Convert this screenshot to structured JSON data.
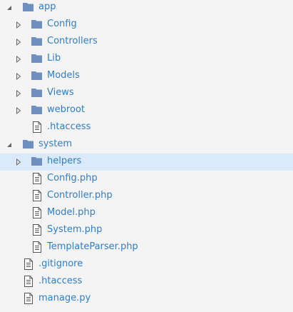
{
  "tree": {
    "nodes": [
      {
        "label": "app",
        "type": "folder",
        "level": 0,
        "state": "expanded"
      },
      {
        "label": "Config",
        "type": "folder",
        "level": 1,
        "state": "collapsed"
      },
      {
        "label": "Controllers",
        "type": "folder",
        "level": 1,
        "state": "collapsed"
      },
      {
        "label": "Lib",
        "type": "folder",
        "level": 1,
        "state": "collapsed"
      },
      {
        "label": "Models",
        "type": "folder",
        "level": 1,
        "state": "collapsed"
      },
      {
        "label": "Views",
        "type": "folder",
        "level": 1,
        "state": "collapsed"
      },
      {
        "label": "webroot",
        "type": "folder",
        "level": 1,
        "state": "collapsed"
      },
      {
        "label": ".htaccess",
        "type": "file",
        "level": 1
      },
      {
        "label": "system",
        "type": "folder",
        "level": 0,
        "state": "expanded"
      },
      {
        "label": "helpers",
        "type": "folder",
        "level": 1,
        "state": "collapsed",
        "selected": true
      },
      {
        "label": "Config.php",
        "type": "file",
        "level": 1
      },
      {
        "label": "Controller.php",
        "type": "file",
        "level": 1
      },
      {
        "label": "Model.php",
        "type": "file",
        "level": 1
      },
      {
        "label": "System.php",
        "type": "file",
        "level": 1
      },
      {
        "label": "TemplateParser.php",
        "type": "file",
        "level": 1
      },
      {
        "label": ".gitignore",
        "type": "file",
        "level": 0
      },
      {
        "label": ".htaccess",
        "type": "file",
        "level": 0
      },
      {
        "label": "manage.py",
        "type": "file",
        "level": 0
      }
    ]
  },
  "colors": {
    "background": "#f4f4f4",
    "selected_background": "#dbeafb",
    "label": "#2f7ec4",
    "folder": "#6f90bf",
    "caret": "#666666",
    "file_outline": "#555555"
  },
  "icons": {
    "folder": "folder-icon",
    "file": "file-icon",
    "expanded": "caret-down-icon",
    "collapsed": "caret-right-icon"
  }
}
